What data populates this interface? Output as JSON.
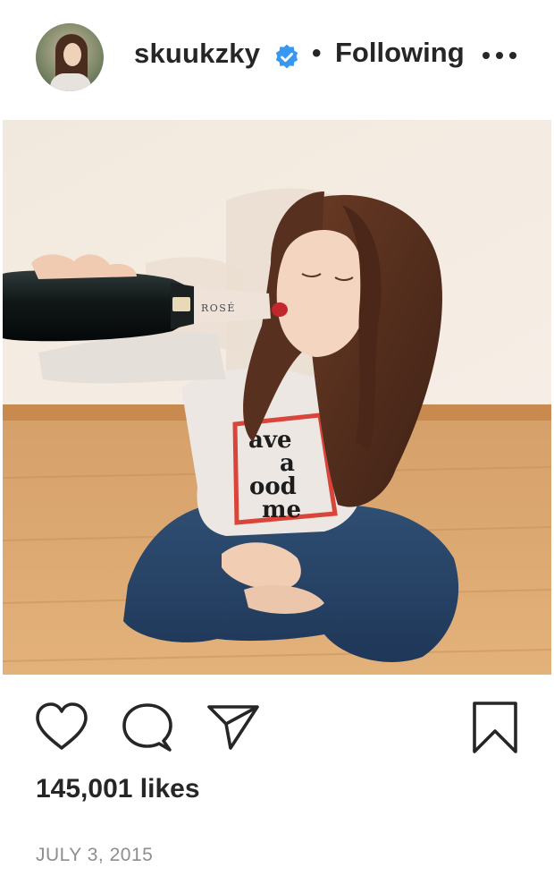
{
  "header": {
    "username": "skuukzky",
    "separator": "•",
    "follow_status": "Following"
  },
  "post": {
    "bottle_label": "ROSÉ",
    "sweater_text_lines": [
      "ave",
      "a",
      "ood",
      "me"
    ]
  },
  "footer": {
    "likes": "145,001 likes",
    "date": "JULY 3, 2015"
  },
  "colors": {
    "verified_badge": "#3897f0",
    "text_primary": "#262626",
    "text_secondary": "#8e8e8e"
  },
  "icons": [
    "verified-badge-icon",
    "more-options-icon",
    "heart-icon",
    "comment-icon",
    "share-icon",
    "bookmark-icon"
  ]
}
